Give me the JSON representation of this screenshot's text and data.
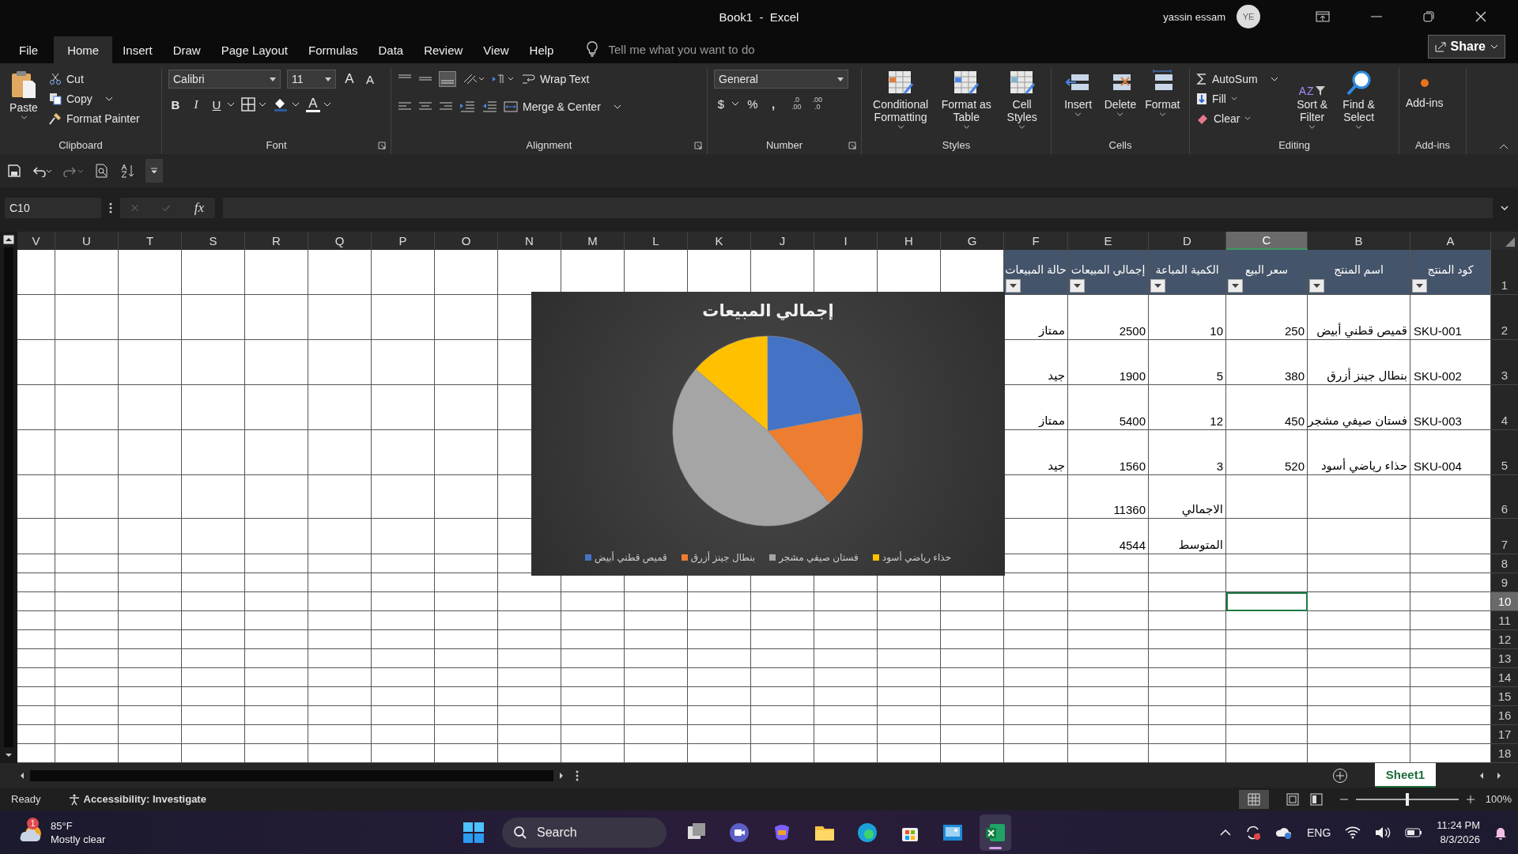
{
  "window": {
    "title": "Book1  -  Excel",
    "user": "yassin essam",
    "avatar": "YE"
  },
  "menu_tabs": [
    {
      "label": "File",
      "selected": false
    },
    {
      "label": "Home",
      "selected": true
    },
    {
      "label": "Insert",
      "selected": false
    },
    {
      "label": "Draw",
      "selected": false
    },
    {
      "label": "Page Layout",
      "selected": false
    },
    {
      "label": "Formulas",
      "selected": false
    },
    {
      "label": "Data",
      "selected": false
    },
    {
      "label": "Review",
      "selected": false
    },
    {
      "label": "View",
      "selected": false
    },
    {
      "label": "Help",
      "selected": false
    }
  ],
  "tell_me": {
    "placeholder": "Tell me what you want to do"
  },
  "share": "Share",
  "ribbon": {
    "clipboard": {
      "label": "Clipboard",
      "paste": "Paste",
      "cut": "Cut",
      "copy": "Copy",
      "format_painter": "Format Painter"
    },
    "font": {
      "label": "Font",
      "font_name": "Calibri",
      "font_size": "11",
      "grow": "A",
      "shrink": "A",
      "bold": "B",
      "italic": "I",
      "underline": "U",
      "font_color": "A"
    },
    "alignment": {
      "label": "Alignment",
      "wrap_text": "Wrap Text",
      "merge_center": "Merge & Center"
    },
    "number": {
      "label": "Number",
      "format": "General",
      "currency": "$",
      "percent": "%",
      "comma": ",",
      "decimals": [
        {
          "top": ".0",
          "bottom": ".00"
        },
        {
          "top": ".00",
          "bottom": ".0"
        }
      ]
    },
    "styles": {
      "label": "Styles",
      "items": [
        "Conditional Formatting",
        "Format as Table",
        "Cell Styles"
      ]
    },
    "cells": {
      "label": "Cells",
      "items": [
        "Insert",
        "Delete",
        "Format"
      ]
    },
    "editing": {
      "label": "Editing",
      "autosum": "AutoSum",
      "fill": "Fill",
      "clear": "Clear",
      "sort_filter": "Sort & Filter",
      "find_select": "Find & Select",
      "sort_letters": [
        "A",
        "Z"
      ]
    },
    "addins": {
      "label": "Add-ins",
      "button": "Add-ins"
    }
  },
  "formula_bar": {
    "name_box": "C10",
    "fx": "fx"
  },
  "sheet": {
    "columns": [
      {
        "label": "V",
        "selected": false
      },
      {
        "label": "U",
        "selected": false
      },
      {
        "label": "T",
        "selected": false
      },
      {
        "label": "S",
        "selected": false
      },
      {
        "label": "R",
        "selected": false
      },
      {
        "label": "Q",
        "selected": false
      },
      {
        "label": "P",
        "selected": false
      },
      {
        "label": "O",
        "selected": false
      },
      {
        "label": "N",
        "selected": false
      },
      {
        "label": "M",
        "selected": false
      },
      {
        "label": "L",
        "selected": false
      },
      {
        "label": "K",
        "selected": false
      },
      {
        "label": "J",
        "selected": false
      },
      {
        "label": "I",
        "selected": false
      },
      {
        "label": "H",
        "selected": false
      },
      {
        "label": "G",
        "selected": false
      },
      {
        "label": "F",
        "selected": false
      },
      {
        "label": "E",
        "selected": false
      },
      {
        "label": "D",
        "selected": false
      },
      {
        "label": "C",
        "selected": true
      },
      {
        "label": "B",
        "selected": false
      },
      {
        "label": "A",
        "selected": false
      }
    ],
    "rows": [
      {
        "label": "1",
        "selected": false
      },
      {
        "label": "2",
        "selected": false
      },
      {
        "label": "3",
        "selected": false
      },
      {
        "label": "4",
        "selected": false
      },
      {
        "label": "5",
        "selected": false
      },
      {
        "label": "6",
        "selected": false
      },
      {
        "label": "7",
        "selected": false
      },
      {
        "label": "8",
        "selected": false
      },
      {
        "label": "9",
        "selected": false
      },
      {
        "label": "10",
        "selected": true
      },
      {
        "label": "11",
        "selected": false
      },
      {
        "label": "12",
        "selected": false
      },
      {
        "label": "13",
        "selected": false
      },
      {
        "label": "14",
        "selected": false
      },
      {
        "label": "15",
        "selected": false
      },
      {
        "label": "16",
        "selected": false
      },
      {
        "label": "17",
        "selected": false
      },
      {
        "label": "18",
        "selected": false
      }
    ],
    "headers": [
      "كود المنتج",
      "اسم المنتج",
      "سعر البيع",
      "الكمية المباعة",
      "إجمالي المبيعات",
      "حالة المبيعات"
    ],
    "products": [
      {
        "code": "SKU-001",
        "name": "قميص قطني أبيض",
        "price": "250",
        "qty": "10",
        "total": "2500",
        "status": "ممتاز"
      },
      {
        "code": "SKU-002",
        "name": "بنطال جينز أزرق",
        "price": "380",
        "qty": "5",
        "total": "1900",
        "status": "جيد"
      },
      {
        "code": "SKU-003",
        "name": "فستان صيفي مشجر",
        "price": "450",
        "qty": "12",
        "total": "5400",
        "status": "ممتاز"
      },
      {
        "code": "SKU-004",
        "name": "حذاء رياضي أسود",
        "price": "520",
        "qty": "3",
        "total": "1560",
        "status": "جيد"
      }
    ],
    "summary": [
      {
        "label": "الاجمالي",
        "value": "11360"
      },
      {
        "label": "المتوسط",
        "value": "4544"
      }
    ]
  },
  "chart": {
    "title": "إجمالي المبيعات",
    "legend": [
      {
        "label": "حذاء رياضي أسود",
        "color": "#ffc000"
      },
      {
        "label": "فستان صيفي مشجر",
        "color": "#a5a5a5"
      },
      {
        "label": "بنطال جينز أزرق",
        "color": "#ed7d31"
      },
      {
        "label": "قميص قطني أبيض",
        "color": "#4472c4"
      }
    ]
  },
  "sheet_tabs": [
    {
      "label": "Sheet1",
      "selected": true
    }
  ],
  "status": {
    "ready": "Ready",
    "accessibility": "Accessibility: Investigate",
    "zoom": "100%",
    "zoom_slider": {
      "level": 0.5
    }
  },
  "taskbar": {
    "weather": {
      "temp": "85°F",
      "condition": "Mostly clear",
      "badge": "1"
    },
    "search": "Search",
    "apps": [
      {
        "kind": "task-view",
        "active": false
      },
      {
        "kind": "meet",
        "active": false
      },
      {
        "kind": "copilot",
        "active": false
      },
      {
        "kind": "folder",
        "active": false
      },
      {
        "kind": "edge",
        "active": false
      },
      {
        "kind": "store",
        "active": false
      },
      {
        "kind": "photos",
        "active": false
      },
      {
        "kind": "excel",
        "active": true
      }
    ],
    "language": "ENG",
    "time": "11:24 PM",
    "date": "8/3/2026"
  }
}
